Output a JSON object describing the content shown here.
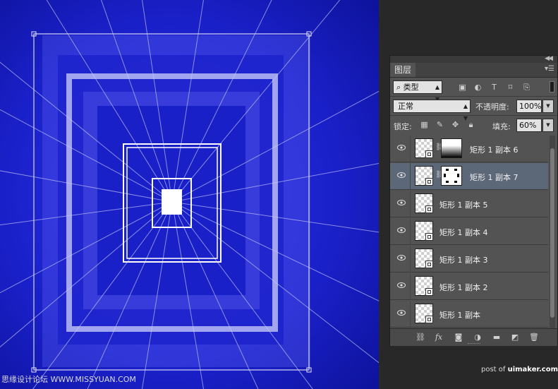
{
  "layers_panel": {
    "tab_title": "图层",
    "filter_kind": "类型",
    "blend_mode": "正常",
    "opacity_label": "不透明度:",
    "opacity_value": "100%",
    "lock_label": "锁定:",
    "fill_label": "填充:",
    "fill_value": "60%",
    "layers": [
      {
        "name": "矩形 1 副本 6",
        "visible": true,
        "has_mask": true,
        "mask": "gradient",
        "selected": false
      },
      {
        "name": "矩形 1 副本 7",
        "visible": true,
        "has_mask": true,
        "mask": "blob",
        "selected": true
      },
      {
        "name": "矩形 1 副本 5",
        "visible": true,
        "has_mask": false,
        "selected": false
      },
      {
        "name": "矩形 1 副本 4",
        "visible": true,
        "has_mask": false,
        "selected": false
      },
      {
        "name": "矩形 1 副本 3",
        "visible": true,
        "has_mask": false,
        "selected": false
      },
      {
        "name": "矩形 1 副本 2",
        "visible": true,
        "has_mask": false,
        "selected": false
      },
      {
        "name": "矩形 1 副本",
        "visible": true,
        "has_mask": false,
        "selected": false
      }
    ],
    "filter_icons": [
      "image-filter-icon",
      "adjustment-filter-icon",
      "type-filter-icon",
      "shape-filter-icon",
      "smart-object-filter-icon"
    ],
    "lock_icons": [
      "lock-transparent-icon",
      "lock-paint-icon",
      "lock-position-icon",
      "lock-all-icon"
    ],
    "bottom_icons": [
      "link-icon",
      "fx-icon",
      "mask-icon",
      "adjustment-icon",
      "folder-icon",
      "new-layer-icon",
      "trash-icon"
    ]
  },
  "watermark_left": "思缘设计论坛 WWW.MISSYUAN.COM",
  "watermark_right_prefix": "post of ",
  "watermark_right_site": "uimaker.com",
  "colors": {
    "canvas_blue": "#1a20c8",
    "selected_layer": "#5c6878",
    "panel_bg": "#535353",
    "app_bg": "#282828"
  }
}
